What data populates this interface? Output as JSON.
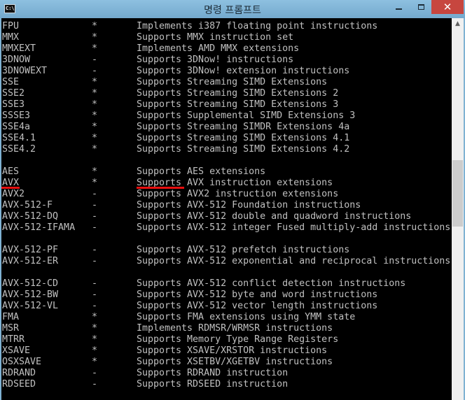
{
  "window": {
    "title": "명령 프롬프트",
    "app_icon_text": "C:\\",
    "close_label": "✕",
    "icons": [
      "cmd-app-icon",
      "minimize-icon",
      "maximize-icon",
      "close-icon",
      "scroll-up-arrow-icon"
    ],
    "colors": {
      "titlebar": "#7fb2d3",
      "close_button": "#c7463f",
      "console_bg": "#000000",
      "console_text": "#c0c0c0",
      "highlight": "#e81010"
    }
  },
  "scrollbar": {
    "up_arrow": "▲"
  },
  "console": {
    "lines": [
      {
        "name": "FPU",
        "flag": "*",
        "desc": "Implements i387 floating point instructions"
      },
      {
        "name": "MMX",
        "flag": "*",
        "desc": "Supports MMX instruction set"
      },
      {
        "name": "MMXEXT",
        "flag": "*",
        "desc": "Implements AMD MMX extensions"
      },
      {
        "name": "3DNOW",
        "flag": "-",
        "desc": "Supports 3DNow! instructions"
      },
      {
        "name": "3DNOWEXT",
        "flag": "-",
        "desc": "Supports 3DNow! extension instructions"
      },
      {
        "name": "SSE",
        "flag": "*",
        "desc": "Supports Streaming SIMD Extensions"
      },
      {
        "name": "SSE2",
        "flag": "*",
        "desc": "Supports Streaming SIMD Extensions 2"
      },
      {
        "name": "SSE3",
        "flag": "*",
        "desc": "Supports Streaming SIMD Extensions 3"
      },
      {
        "name": "SSSE3",
        "flag": "*",
        "desc": "Supports Supplemental SIMD Extensions 3"
      },
      {
        "name": "SSE4a",
        "flag": "*",
        "desc": "Supports Streaming SIMDR Extensions 4a"
      },
      {
        "name": "SSE4.1",
        "flag": "*",
        "desc": "Supports Streaming SIMD Extensions 4.1"
      },
      {
        "name": "SSE4.2",
        "flag": "*",
        "desc": "Supports Streaming SIMD Extensions 4.2"
      },
      {
        "name": "",
        "flag": "",
        "desc": ""
      },
      {
        "name": "AES",
        "flag": "*",
        "desc": "Supports AES extensions"
      },
      {
        "name": "AVX",
        "flag": "*",
        "desc": "Supports AVX instruction extensions",
        "highlight": true
      },
      {
        "name": "AVX2",
        "flag": "-",
        "desc": "Supports AVX2 instruction extensions"
      },
      {
        "name": "AVX-512-F",
        "flag": "-",
        "desc": "Supports AVX-512 Foundation instructions"
      },
      {
        "name": "AVX-512-DQ",
        "flag": "-",
        "desc": "Supports AVX-512 double and quadword instructions"
      },
      {
        "name": "AVX-512-IFAMA",
        "flag": "-",
        "desc": "Supports AVX-512 integer Fused multiply-add instructions"
      },
      {
        "name": "",
        "flag": "",
        "desc": ""
      },
      {
        "name": "AVX-512-PF",
        "flag": "-",
        "desc": "Supports AVX-512 prefetch instructions"
      },
      {
        "name": "AVX-512-ER",
        "flag": "-",
        "desc": "Supports AVX-512 exponential and reciprocal instructions"
      },
      {
        "name": "",
        "flag": "",
        "desc": ""
      },
      {
        "name": "AVX-512-CD",
        "flag": "-",
        "desc": "Supports AVX-512 conflict detection instructions"
      },
      {
        "name": "AVX-512-BW",
        "flag": "-",
        "desc": "Supports AVX-512 byte and word instructions"
      },
      {
        "name": "AVX-512-VL",
        "flag": "-",
        "desc": "Supports AVX-512 vector length instructions"
      },
      {
        "name": "FMA",
        "flag": "*",
        "desc": "Supports FMA extensions using YMM state"
      },
      {
        "name": "MSR",
        "flag": "*",
        "desc": "Implements RDMSR/WRMSR instructions"
      },
      {
        "name": "MTRR",
        "flag": "*",
        "desc": "Supports Memory Type Range Registers"
      },
      {
        "name": "XSAVE",
        "flag": "*",
        "desc": "Supports XSAVE/XRSTOR instructions"
      },
      {
        "name": "OSXSAVE",
        "flag": "*",
        "desc": "Supports XSETBV/XGETBV instructions"
      },
      {
        "name": "RDRAND",
        "flag": "-",
        "desc": "Supports RDRAND instruction"
      },
      {
        "name": "RDSEED",
        "flag": "-",
        "desc": "Supports RDSEED instruction"
      }
    ]
  }
}
